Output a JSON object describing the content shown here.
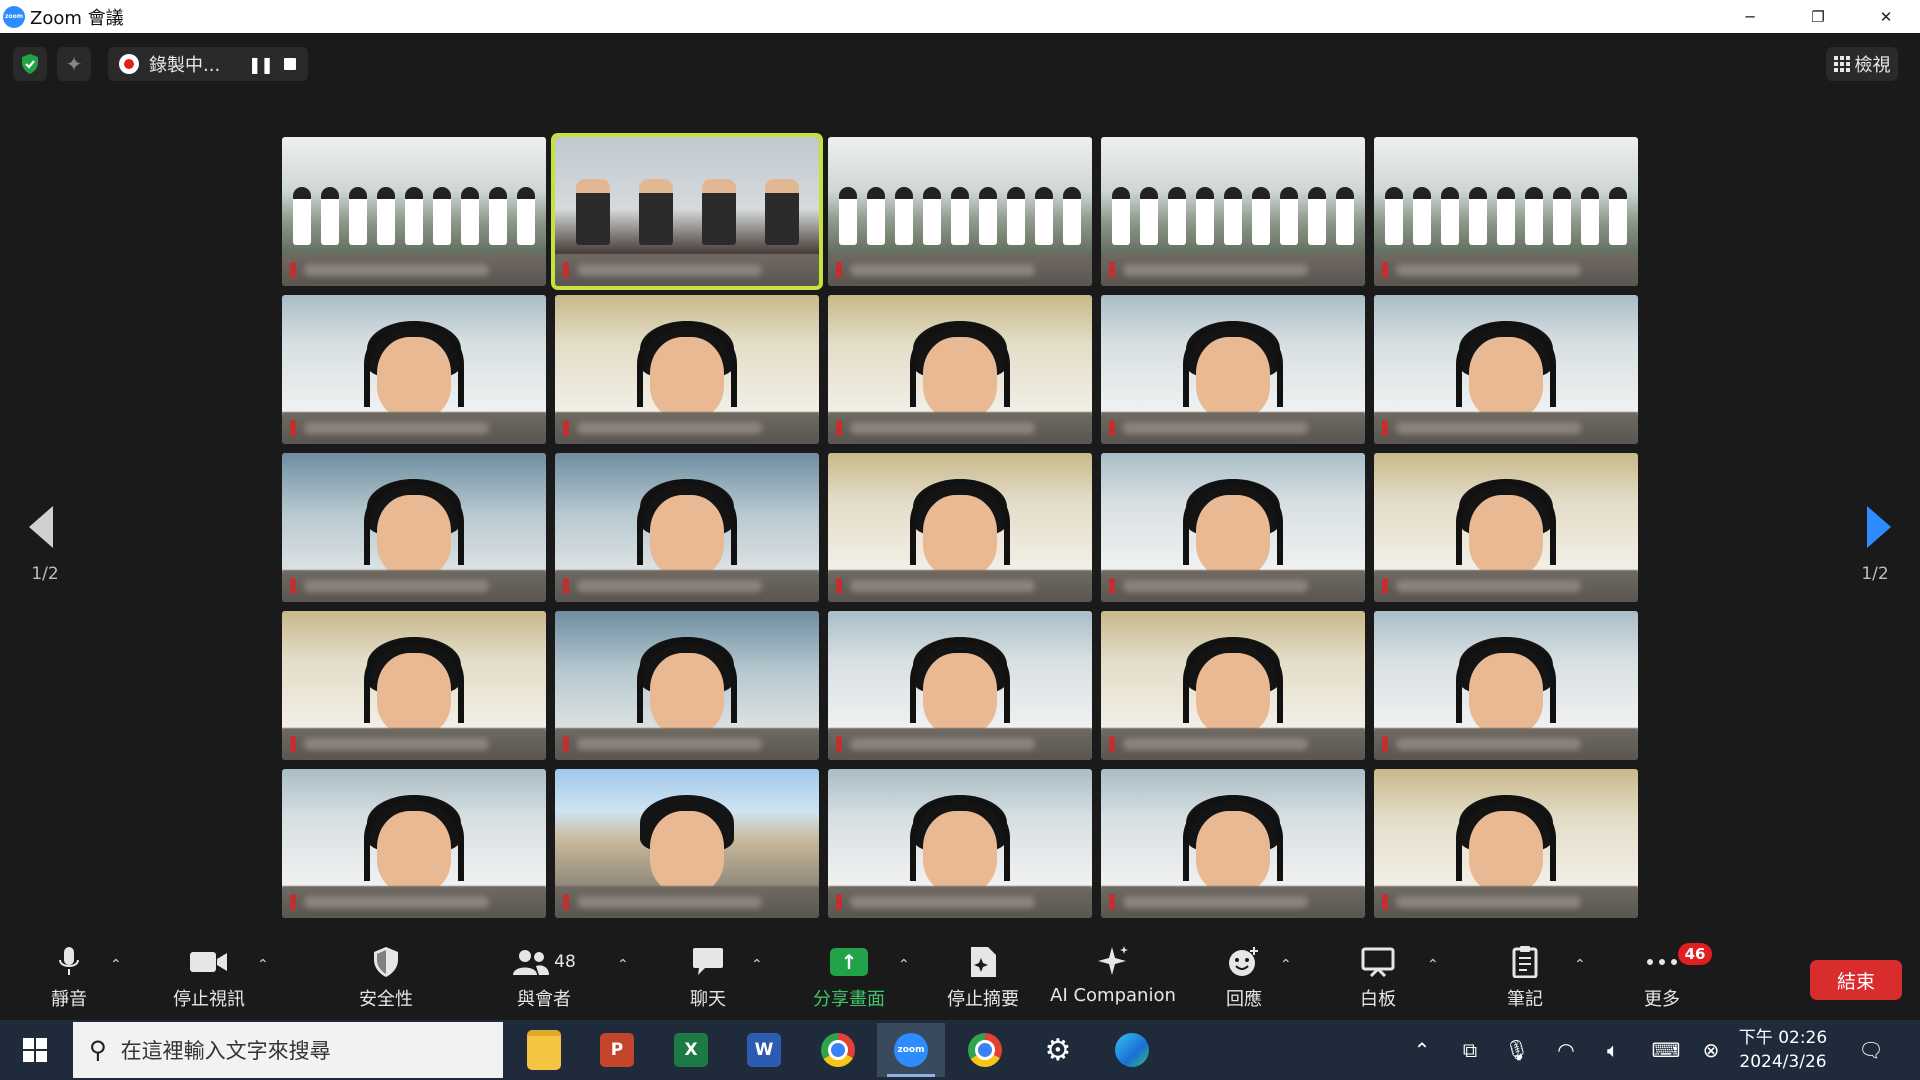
{
  "window": {
    "app_icon_text": "zoom",
    "title": "Zoom 會議",
    "minimize": "─",
    "restore": "❐",
    "close": "✕"
  },
  "topbar": {
    "recording_label": "錄製中...",
    "pause_glyph": "❚❚",
    "view_label": "檢視",
    "view_icon": "grid-icon"
  },
  "gallery": {
    "page_indicator_left": "1/2",
    "page_indicator_right": "1/2",
    "tiles": [
      {
        "type": "classroom",
        "speaking": false
      },
      {
        "type": "officials",
        "speaking": true
      },
      {
        "type": "classroom",
        "speaking": false
      },
      {
        "type": "classroom",
        "speaking": false
      },
      {
        "type": "classroom",
        "speaking": false
      },
      {
        "type": "person",
        "bg": "room-b",
        "speaking": false
      },
      {
        "type": "person",
        "bg": "room-c",
        "speaking": false
      },
      {
        "type": "person",
        "bg": "room-c",
        "speaking": false
      },
      {
        "type": "person",
        "bg": "room-b",
        "speaking": false
      },
      {
        "type": "person",
        "bg": "room-b",
        "speaking": false
      },
      {
        "type": "person",
        "bg": "room-d",
        "speaking": false
      },
      {
        "type": "person",
        "bg": "room-d",
        "speaking": false
      },
      {
        "type": "person",
        "bg": "room-c",
        "speaking": false
      },
      {
        "type": "person",
        "bg": "room-b",
        "speaking": false
      },
      {
        "type": "person",
        "bg": "room-c",
        "speaking": false
      },
      {
        "type": "person",
        "bg": "room-c",
        "speaking": false
      },
      {
        "type": "person",
        "bg": "room-d",
        "speaking": false
      },
      {
        "type": "person",
        "bg": "room-b",
        "speaking": false
      },
      {
        "type": "person",
        "bg": "room-c",
        "speaking": false
      },
      {
        "type": "person",
        "bg": "room-b",
        "speaking": false
      },
      {
        "type": "person",
        "bg": "room-b",
        "speaking": false
      },
      {
        "type": "school",
        "bg": "school-bg",
        "speaking": false
      },
      {
        "type": "person",
        "bg": "room-b",
        "speaking": false
      },
      {
        "type": "person",
        "bg": "room-b",
        "speaking": false
      },
      {
        "type": "person",
        "bg": "room-c",
        "speaking": false
      }
    ]
  },
  "toolbar": {
    "mute": {
      "label": "靜音",
      "icon": "microphone-icon"
    },
    "stop_video": {
      "label": "停止視訊",
      "icon": "video-camera-icon"
    },
    "security": {
      "label": "安全性",
      "icon": "shield-icon"
    },
    "participants": {
      "label": "與會者",
      "icon": "participants-icon",
      "count": "48"
    },
    "chat": {
      "label": "聊天",
      "icon": "chat-icon"
    },
    "share_screen": {
      "label": "分享畫面",
      "icon": "share-screen-icon"
    },
    "stop_summary": {
      "label": "停止摘要",
      "icon": "summary-icon"
    },
    "ai_companion": {
      "label": "AI Companion",
      "icon": "sparkle-icon"
    },
    "reactions": {
      "label": "回應",
      "icon": "emoji-icon"
    },
    "whiteboard": {
      "label": "白板",
      "icon": "whiteboard-icon"
    },
    "notes": {
      "label": "筆記",
      "icon": "notes-icon"
    },
    "more": {
      "label": "更多",
      "icon": "more-icon",
      "badge": "46"
    },
    "end": {
      "label": "結束"
    }
  },
  "taskbar": {
    "search_placeholder": "在這裡輸入文字來搜尋",
    "apps": [
      {
        "name": "file-explorer",
        "label": ""
      },
      {
        "name": "powerpoint",
        "label": "P"
      },
      {
        "name": "excel",
        "label": "X"
      },
      {
        "name": "word",
        "label": "W"
      },
      {
        "name": "chrome",
        "label": ""
      },
      {
        "name": "zoom",
        "label": "zoom"
      },
      {
        "name": "chrome-2",
        "label": ""
      },
      {
        "name": "settings",
        "label": "⚙"
      },
      {
        "name": "edge",
        "label": ""
      }
    ],
    "time": "下午 02:26",
    "date": "2024/3/26"
  },
  "colors": {
    "accent_blue": "#2d8cff",
    "share_green": "#21a34a",
    "end_red": "#d92c2c",
    "active_speaker": "#c7e23a"
  }
}
